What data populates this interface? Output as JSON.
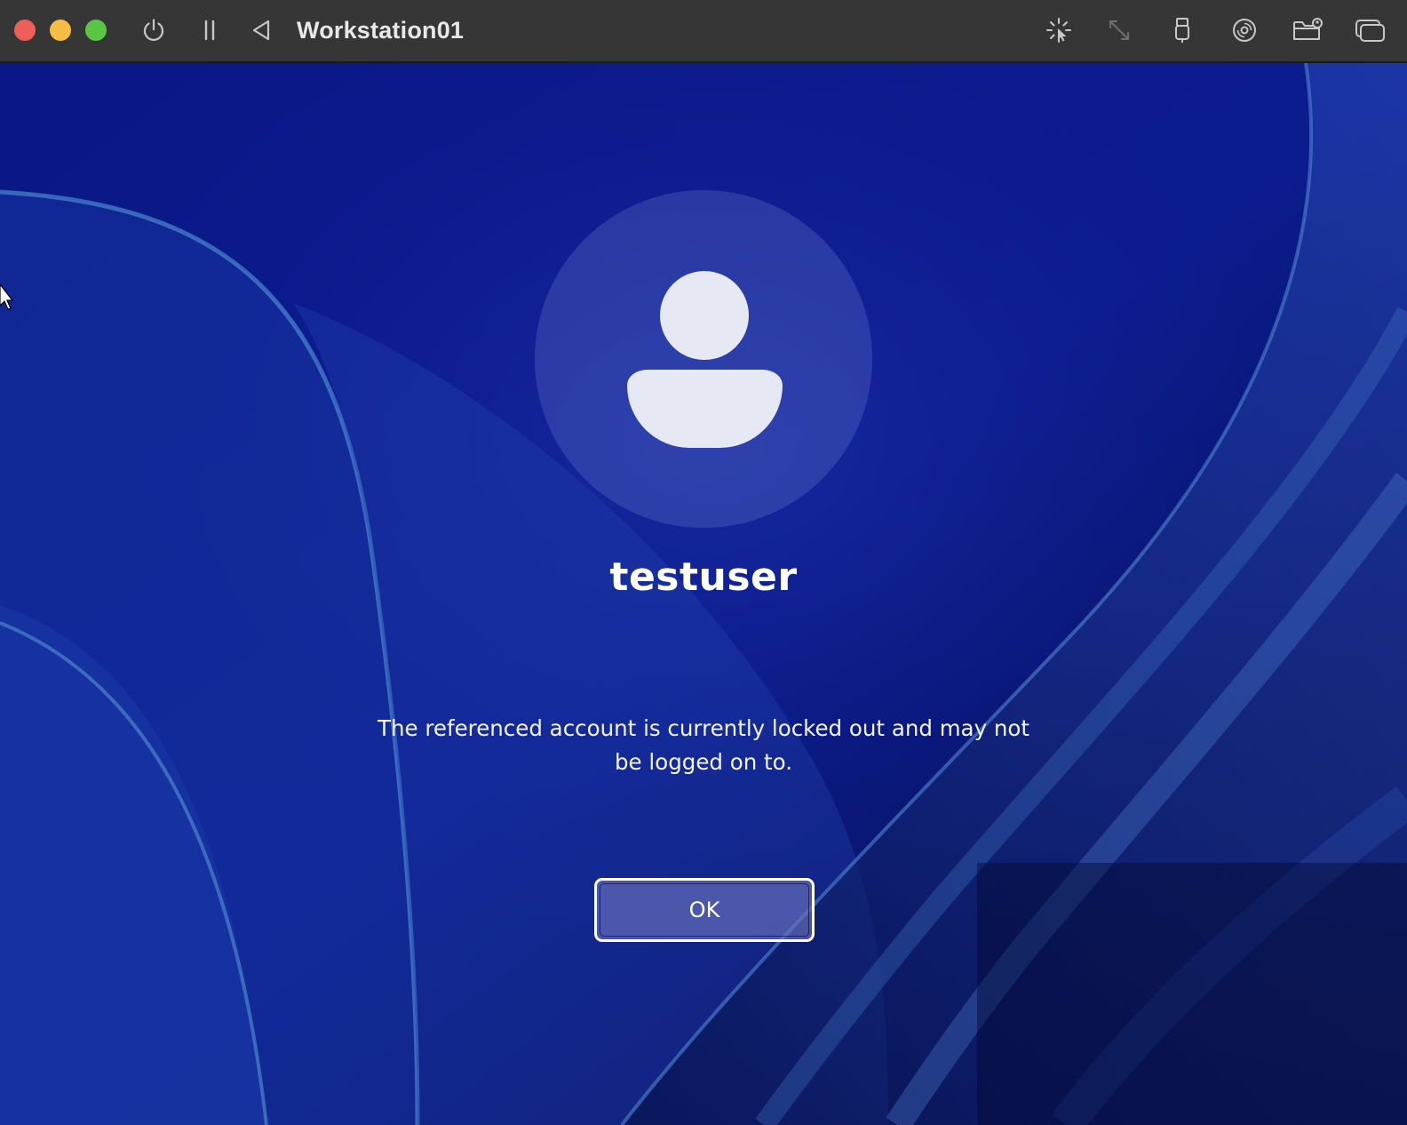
{
  "window": {
    "title": "Workstation01",
    "controls": [
      {
        "name": "close-button",
        "color": "#ed5f58"
      },
      {
        "name": "minimize-button",
        "color": "#f6bd44"
      },
      {
        "name": "zoom-button",
        "color": "#5ac645"
      }
    ]
  },
  "toolbar": {
    "left_icons": [
      "power-icon",
      "pause-icon",
      "back-triangle-icon"
    ],
    "right_icons": [
      "capture-pointer-icon",
      "resize-arrows-icon",
      "usb-icon",
      "disc-icon",
      "shared-folder-icon",
      "windows-overlap-icon"
    ]
  },
  "login": {
    "username": "testuser",
    "message": "The referenced account is currently locked out and may not be logged on to.",
    "ok_label": "OK",
    "avatar_icon": "user-avatar-icon"
  },
  "colors": {
    "titlebar": "#363636",
    "wallpaper_base": "#0a1a8c",
    "ok_button_fill": "#6e76be",
    "text": "#ffffff"
  }
}
